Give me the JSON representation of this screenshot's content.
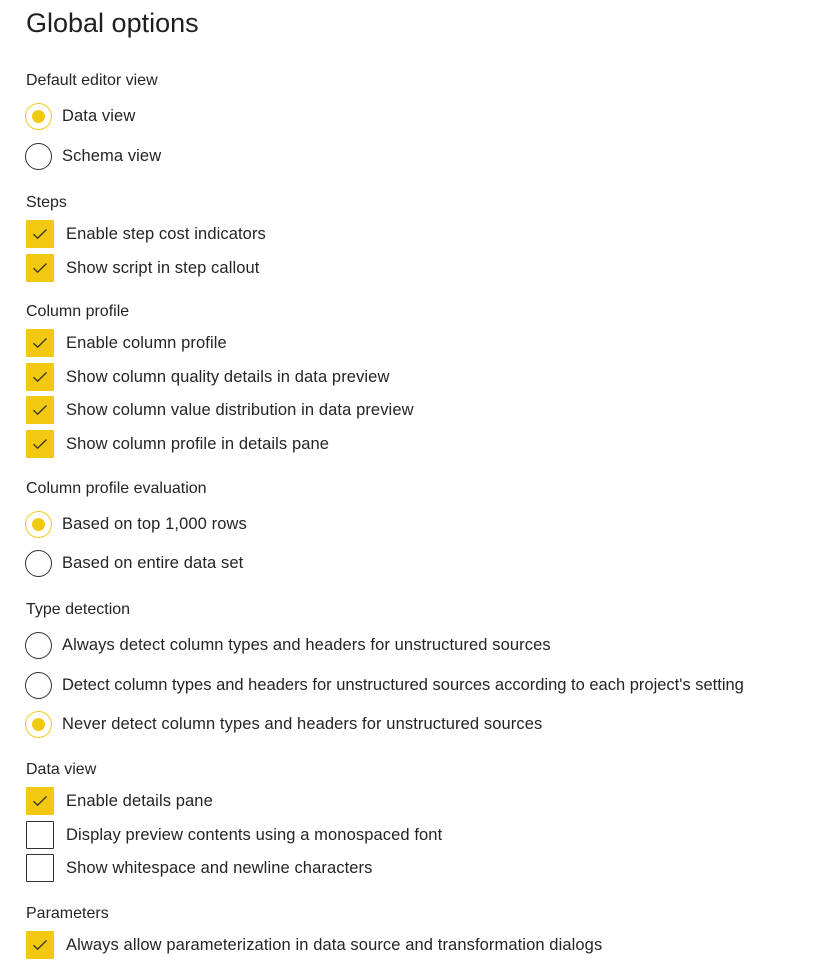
{
  "page": {
    "title": "Global options"
  },
  "colors": {
    "accent": "#f2c811",
    "text": "#252423",
    "border": "#323130"
  },
  "sections": {
    "default_editor_view": {
      "label": "Default editor view",
      "options": [
        {
          "label": "Data view",
          "selected": true
        },
        {
          "label": "Schema view",
          "selected": false
        }
      ]
    },
    "steps": {
      "label": "Steps",
      "options": [
        {
          "label": "Enable step cost indicators",
          "checked": true
        },
        {
          "label": "Show script in step callout",
          "checked": true
        }
      ]
    },
    "column_profile": {
      "label": "Column profile",
      "options": [
        {
          "label": "Enable column profile",
          "checked": true
        },
        {
          "label": "Show column quality details in data preview",
          "checked": true
        },
        {
          "label": "Show column value distribution in data preview",
          "checked": true
        },
        {
          "label": "Show column profile in details pane",
          "checked": true
        }
      ]
    },
    "column_profile_evaluation": {
      "label": "Column profile evaluation",
      "options": [
        {
          "label": "Based on top 1,000 rows",
          "selected": true
        },
        {
          "label": "Based on entire data set",
          "selected": false
        }
      ]
    },
    "type_detection": {
      "label": "Type detection",
      "options": [
        {
          "label": "Always detect column types and headers for unstructured sources",
          "selected": false
        },
        {
          "label": "Detect column types and headers for unstructured sources according to each project's setting",
          "selected": false
        },
        {
          "label": "Never detect column types and headers for unstructured sources",
          "selected": true
        }
      ]
    },
    "data_view": {
      "label": "Data view",
      "options": [
        {
          "label": "Enable details pane",
          "checked": true
        },
        {
          "label": "Display preview contents using a monospaced font",
          "checked": false
        },
        {
          "label": "Show whitespace and newline characters",
          "checked": false
        }
      ]
    },
    "parameters": {
      "label": "Parameters",
      "options": [
        {
          "label": "Always allow parameterization in data source and transformation dialogs",
          "checked": true
        }
      ]
    }
  }
}
